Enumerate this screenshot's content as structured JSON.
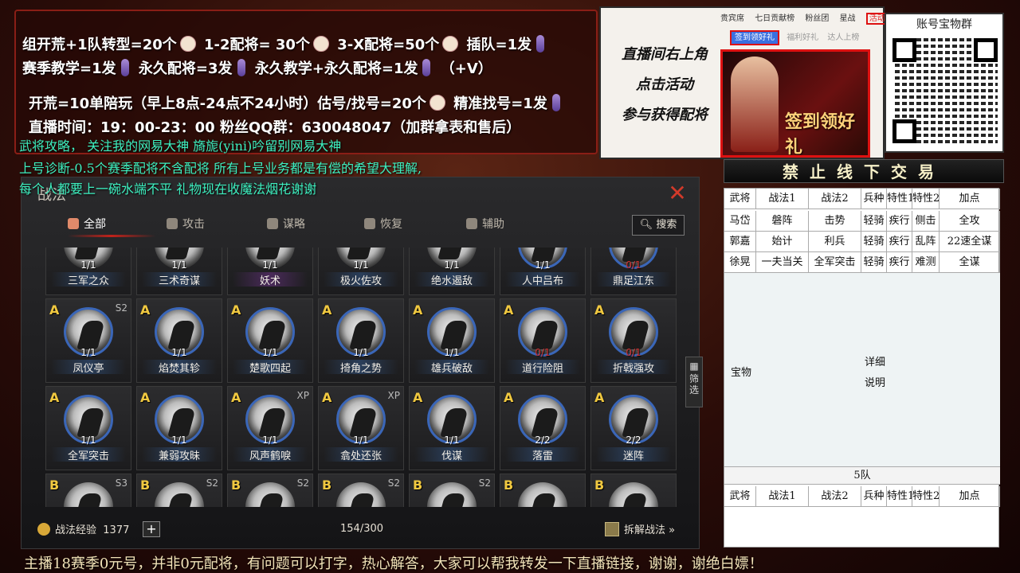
{
  "promo": {
    "line1": [
      "组开荒+1队转型=20个",
      "1-2配将= 30个",
      "3-X配将=50个",
      "插队=1发"
    ],
    "line2": [
      "赛季教学=1发",
      "永久配将=3发",
      "永久教学+永久配将=1发",
      "（+V）"
    ],
    "line3": [
      "开荒=10单陪玩（早上8点-24点不24小时）估号/找号=20个",
      "精准找号=1发"
    ],
    "line4": "直播时间：19：00-23：00   粉丝QQ群：630048047（加群拿表和售后）",
    "cyan1": "武将攻略， 关注我的网易大神 旖旎(yini)吟留别网易大神",
    "cyan2": "上号诊断-0.5个赛季配将不含配将 所有上号业务都是有偿的希望大理解,",
    "cyan3": "每个人都要上一碗水端不平 礼物现在收魔法烟花谢谢"
  },
  "activity": {
    "guide": [
      "直播间右上角",
      "点击活动",
      "参与获得配将"
    ],
    "top_tabs": [
      "贵宾席",
      "七日贡献榜",
      "粉丝团",
      "星战",
      "活动"
    ],
    "sub_tabs": [
      "签到领好礼",
      "福利好礼",
      "达人上榜"
    ],
    "banner_title": "签到领好礼"
  },
  "qr": {
    "title": "账号宝物群"
  },
  "warning": "禁止线下交易",
  "tactics": {
    "title": "战法",
    "tabs": [
      {
        "label": "全部",
        "active": true
      },
      {
        "label": "攻击",
        "active": false
      },
      {
        "label": "谋略",
        "active": false
      },
      {
        "label": "恢复",
        "active": false
      },
      {
        "label": "辅助",
        "active": false
      }
    ],
    "search_label": "搜索",
    "rows": [
      [
        {
          "grade": "",
          "season": "",
          "count": "1/1",
          "name": "三军之众",
          "blue": false
        },
        {
          "grade": "",
          "season": "",
          "count": "1/1",
          "name": "三术奇谋",
          "blue": false
        },
        {
          "grade": "",
          "season": "",
          "count": "1/1",
          "name": "妖术",
          "blue": false,
          "purple": true
        },
        {
          "grade": "",
          "season": "",
          "count": "1/1",
          "name": "极火佐攻",
          "blue": false
        },
        {
          "grade": "",
          "season": "",
          "count": "1/1",
          "name": "绝水遏敌",
          "blue": false
        },
        {
          "grade": "",
          "season": "",
          "count": "1/1",
          "name": "人中吕布",
          "blue": true
        },
        {
          "grade": "",
          "season": "",
          "count": "0/1",
          "name": "鼎足江东",
          "blue": true,
          "red": true
        }
      ],
      [
        {
          "grade": "A",
          "season": "S2",
          "count": "1/1",
          "name": "凤仪亭",
          "blue": true
        },
        {
          "grade": "A",
          "season": "",
          "count": "1/1",
          "name": "焰焚其轸",
          "blue": true
        },
        {
          "grade": "A",
          "season": "",
          "count": "1/1",
          "name": "楚歌四起",
          "blue": true
        },
        {
          "grade": "A",
          "season": "",
          "count": "1/1",
          "name": "掎角之势",
          "blue": true
        },
        {
          "grade": "A",
          "season": "",
          "count": "1/1",
          "name": "雄兵破敌",
          "blue": true
        },
        {
          "grade": "A",
          "season": "",
          "count": "0/1",
          "name": "道行险阻",
          "blue": true,
          "red": true
        },
        {
          "grade": "A",
          "season": "",
          "count": "0/1",
          "name": "折戟强攻",
          "blue": true,
          "red": true
        }
      ],
      [
        {
          "grade": "A",
          "season": "",
          "count": "1/1",
          "name": "全军突击",
          "blue": true
        },
        {
          "grade": "A",
          "season": "",
          "count": "1/1",
          "name": "兼弱攻昧",
          "blue": true
        },
        {
          "grade": "A",
          "season": "XP",
          "count": "1/1",
          "name": "风声鹤唳",
          "blue": true
        },
        {
          "grade": "A",
          "season": "XP",
          "count": "1/1",
          "name": "翕处还张",
          "blue": true
        },
        {
          "grade": "A",
          "season": "",
          "count": "1/1",
          "name": "伐谋",
          "blue": true
        },
        {
          "grade": "A",
          "season": "",
          "count": "2/2",
          "name": "落雷",
          "blue": true
        },
        {
          "grade": "A",
          "season": "",
          "count": "2/2",
          "name": "迷阵",
          "blue": true
        }
      ],
      [
        {
          "grade": "B",
          "season": "S3",
          "count": "",
          "name": "",
          "blue": false
        },
        {
          "grade": "B",
          "season": "S2",
          "count": "",
          "name": "",
          "blue": false
        },
        {
          "grade": "B",
          "season": "S2",
          "count": "",
          "name": "",
          "blue": false
        },
        {
          "grade": "B",
          "season": "S2",
          "count": "",
          "name": "",
          "blue": false
        },
        {
          "grade": "B",
          "season": "S2",
          "count": "",
          "name": "",
          "blue": false
        },
        {
          "grade": "B",
          "season": "",
          "count": "",
          "name": "",
          "blue": false
        },
        {
          "grade": "B",
          "season": "",
          "count": "",
          "name": "",
          "blue": false
        }
      ]
    ],
    "exp_label": "战法经验",
    "exp_value": "1377",
    "page_count": "154/300",
    "dismantle_label": "拆解战法 »",
    "filter_label": "筛选"
  },
  "sheet": {
    "header": [
      "武将",
      "战法1",
      "战法2",
      "兵种",
      "特性1",
      "特性2",
      "加点"
    ],
    "rows": [
      [
        "马岱",
        "磐阵",
        "击势",
        "轻骑",
        "疾行",
        "侧击",
        "全攻"
      ],
      [
        "郭嘉",
        "始计",
        "利兵",
        "轻骑",
        "疾行",
        "乱阵",
        "22速全谋"
      ],
      [
        "徐晃",
        "一夫当关",
        "全军突击",
        "轻骑",
        "疾行",
        "难测",
        "全谋"
      ]
    ],
    "treasure_label": "宝物",
    "detail_label": "详细\n说明",
    "team_label": "5队",
    "header2": [
      "武将",
      "战法1",
      "战法2",
      "兵种",
      "特性1",
      "特性2",
      "加点"
    ]
  },
  "ticker": "主播18赛季0元号，并非0元配将，有问题可以打字，热心解答，大家可以帮我转发一下直播链接，谢谢，谢绝白嫖！"
}
